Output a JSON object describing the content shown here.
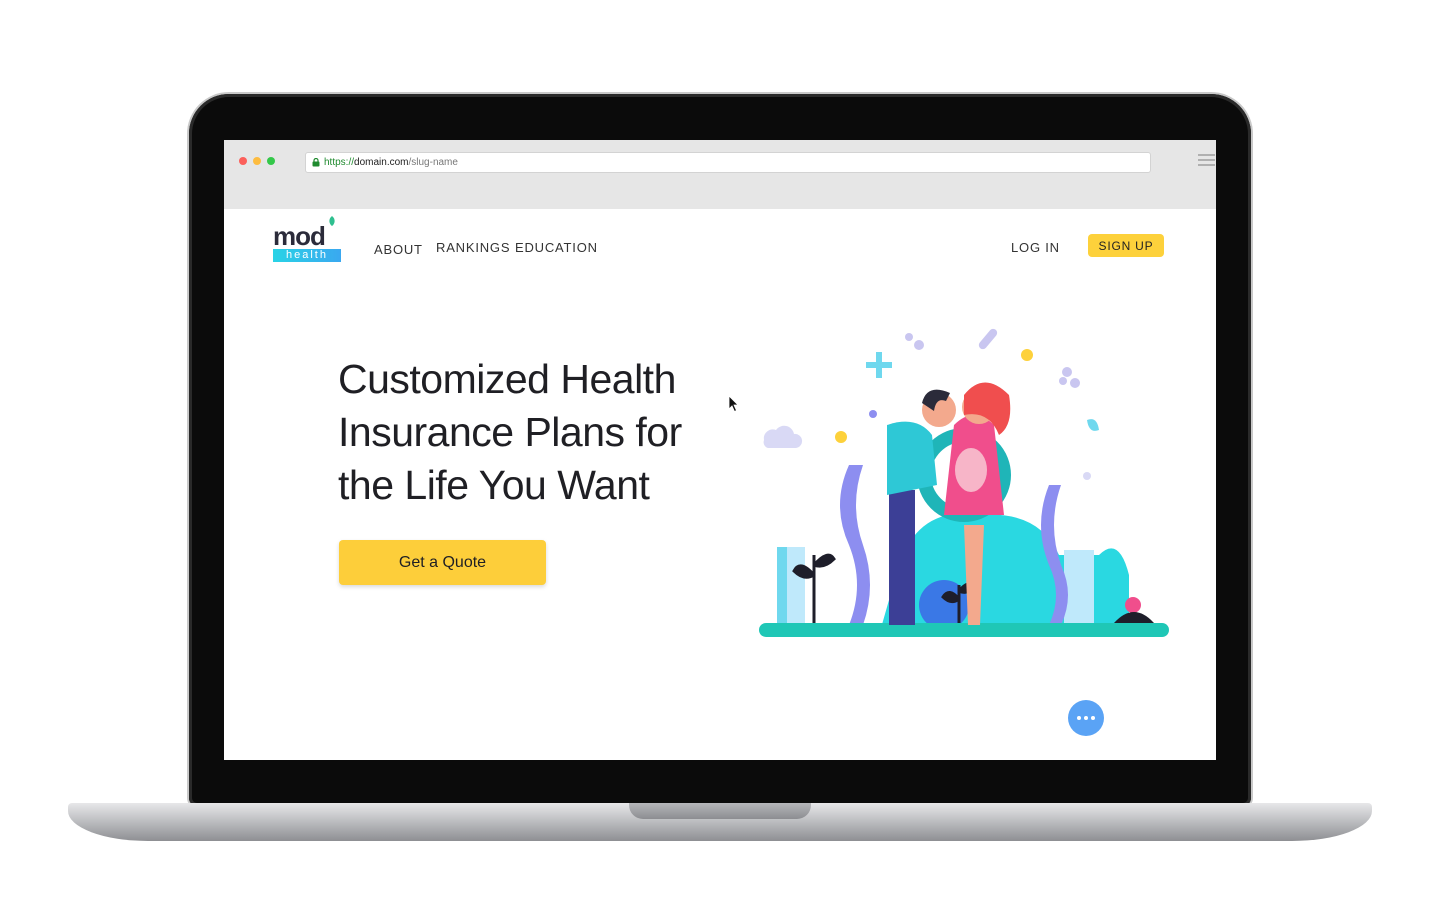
{
  "browser": {
    "url_scheme": "https://",
    "url_domain": "domain.com",
    "url_path": "/slug-name"
  },
  "nav": {
    "logo_top": "mod",
    "logo_bottom": "health",
    "links": [
      "ABOUT",
      "RANKINGS",
      "EDUCATION"
    ],
    "login": "LOG IN",
    "signup": "SIGN UP"
  },
  "hero": {
    "title": "Customized Health Insurance Plans for the Life You Want",
    "cta": "Get a Quote"
  },
  "icons": {
    "lock": "lock-icon",
    "menu": "hamburger-menu-icon",
    "chat": "chat-ellipsis-icon",
    "cursor": "mouse-pointer-icon"
  },
  "colors": {
    "accent_yellow": "#fdd13b",
    "brand_teal": "#29d3e6",
    "chat_blue": "#5aa3f5"
  }
}
